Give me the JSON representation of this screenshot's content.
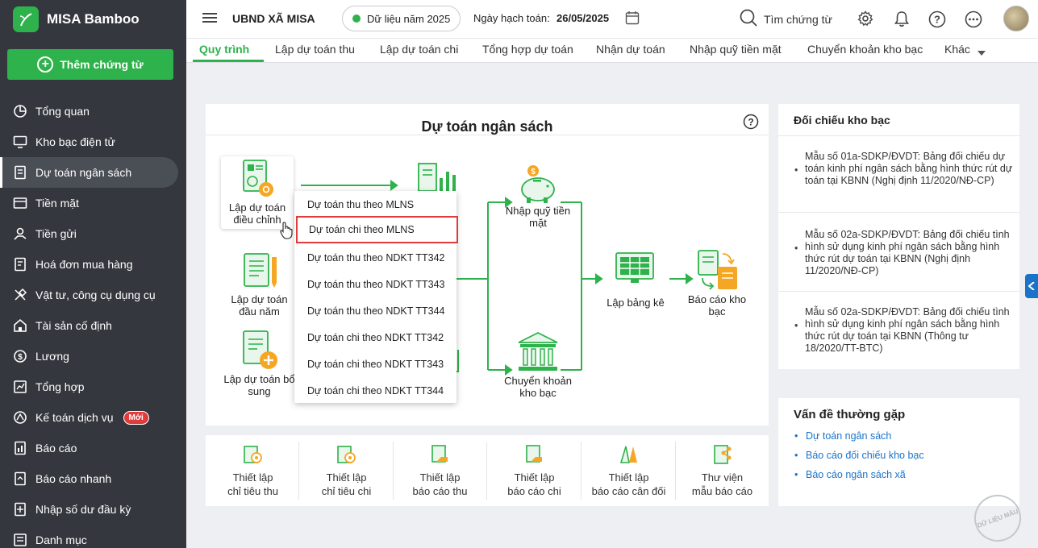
{
  "app": {
    "name": "MISA Bamboo",
    "add_button": "Thêm chứng từ"
  },
  "sidebar": {
    "items": [
      {
        "label": "Tổng quan",
        "icon": "pie-chart-icon"
      },
      {
        "label": "Kho bạc điện tử",
        "icon": "monitor-icon"
      },
      {
        "label": "Dự toán ngân sách",
        "icon": "budget-icon",
        "active": true
      },
      {
        "label": "Tiền mặt",
        "icon": "cash-icon"
      },
      {
        "label": "Tiền gửi",
        "icon": "deposit-icon"
      },
      {
        "label": "Hoá đơn mua hàng",
        "icon": "invoice-icon"
      },
      {
        "label": "Vật tư, công cụ dụng cụ",
        "icon": "tools-icon"
      },
      {
        "label": "Tài sản cố định",
        "icon": "building-icon"
      },
      {
        "label": "Lương",
        "icon": "salary-icon"
      },
      {
        "label": "Tổng hợp",
        "icon": "summary-icon"
      },
      {
        "label": "Kế toán dịch vụ",
        "icon": "service-icon",
        "badge": "Mới"
      },
      {
        "label": "Báo cáo",
        "icon": "report-icon"
      },
      {
        "label": "Báo cáo nhanh",
        "icon": "quick-report-icon"
      },
      {
        "label": "Nhập số dư đầu kỳ",
        "icon": "import-balance-icon"
      },
      {
        "label": "Danh mục",
        "icon": "catalog-icon"
      }
    ]
  },
  "header": {
    "org": "UBND XÃ MISA",
    "year": "Dữ liệu năm 2025",
    "date_label": "Ngày hạch toán:",
    "date": "26/05/2025",
    "search": "Tìm chứng từ"
  },
  "tabs": [
    "Quy trình",
    "Lập dự toán thu",
    "Lập dự toán chi",
    "Tổng hợp dự toán",
    "Nhận dự toán",
    "Nhập quỹ tiền mặt",
    "Chuyển khoản kho bạc",
    "Khác"
  ],
  "main": {
    "title": "Dự toán ngân sách",
    "flow": {
      "adjust": "Lập dự toán điều chỉnh",
      "start": "Lập dự toán đầu năm",
      "extra": "Lập dự toán bổ sung",
      "cash": "Nhập quỹ tiền mặt",
      "transfer": "Chuyển khoản kho bạc",
      "list": "Lập bảng kê",
      "report": "Báo cáo kho bạc"
    },
    "dropdown": [
      "Dự toán thu theo MLNS",
      "Dự toán chi theo MLNS",
      "Dự toán thu theo NDKT TT342",
      "Dự toán thu theo NDKT TT343",
      "Dự toán thu theo NDKT TT344",
      "Dự toán chi theo NDKT TT342",
      "Dự toán chi theo NDKT TT343",
      "Dự toán chi theo NDKT TT344"
    ]
  },
  "bottom": [
    {
      "line1": "Thiết lập",
      "line2": "chỉ tiêu thu"
    },
    {
      "line1": "Thiết lập",
      "line2": "chỉ tiêu chi"
    },
    {
      "line1": "Thiết lập",
      "line2": "báo cáo thu"
    },
    {
      "line1": "Thiết lập",
      "line2": "báo cáo chi"
    },
    {
      "line1": "Thiết lập",
      "line2": "báo cáo cân đối"
    },
    {
      "line1": "Thư viện",
      "line2": "mẫu báo cáo"
    }
  ],
  "right": {
    "reconcile_title": "Đối chiếu kho bạc",
    "docs": [
      "Mẫu số 01a-SDKP/ĐVDT: Bảng đối chiếu dự toán kinh phí ngân sách bằng hình thức rút dự toán tại KBNN (Nghị định 11/2020/NĐ-CP)",
      "Mẫu số 02a-SDKP/ĐVDT: Bảng đối chiếu tình hình sử dụng kinh phí ngân sách bằng hình thức rút dự toán tại KBNN (Nghị định 11/2020/NĐ-CP)",
      "Mẫu số 02a-SDKP/ĐVDT: Bảng đối chiếu tình hình sử dụng kinh phí ngân sách bằng hình thức rút dự toán tại KBNN (Thông tư 18/2020/TT-BTC)"
    ],
    "faq_title": "Vấn đề thường gặp",
    "faq": [
      "Dự toán ngân sách",
      "Báo cáo đối chiếu kho bạc",
      "Báo cáo ngân sách xã"
    ]
  },
  "watermark": "DỮ LIỆU MẪU",
  "colors": {
    "brand": "#2eb24b",
    "sidebar": "#34373d",
    "link": "#1a73c8",
    "highlight": "#e23b3b",
    "accent": "#f5a623"
  }
}
